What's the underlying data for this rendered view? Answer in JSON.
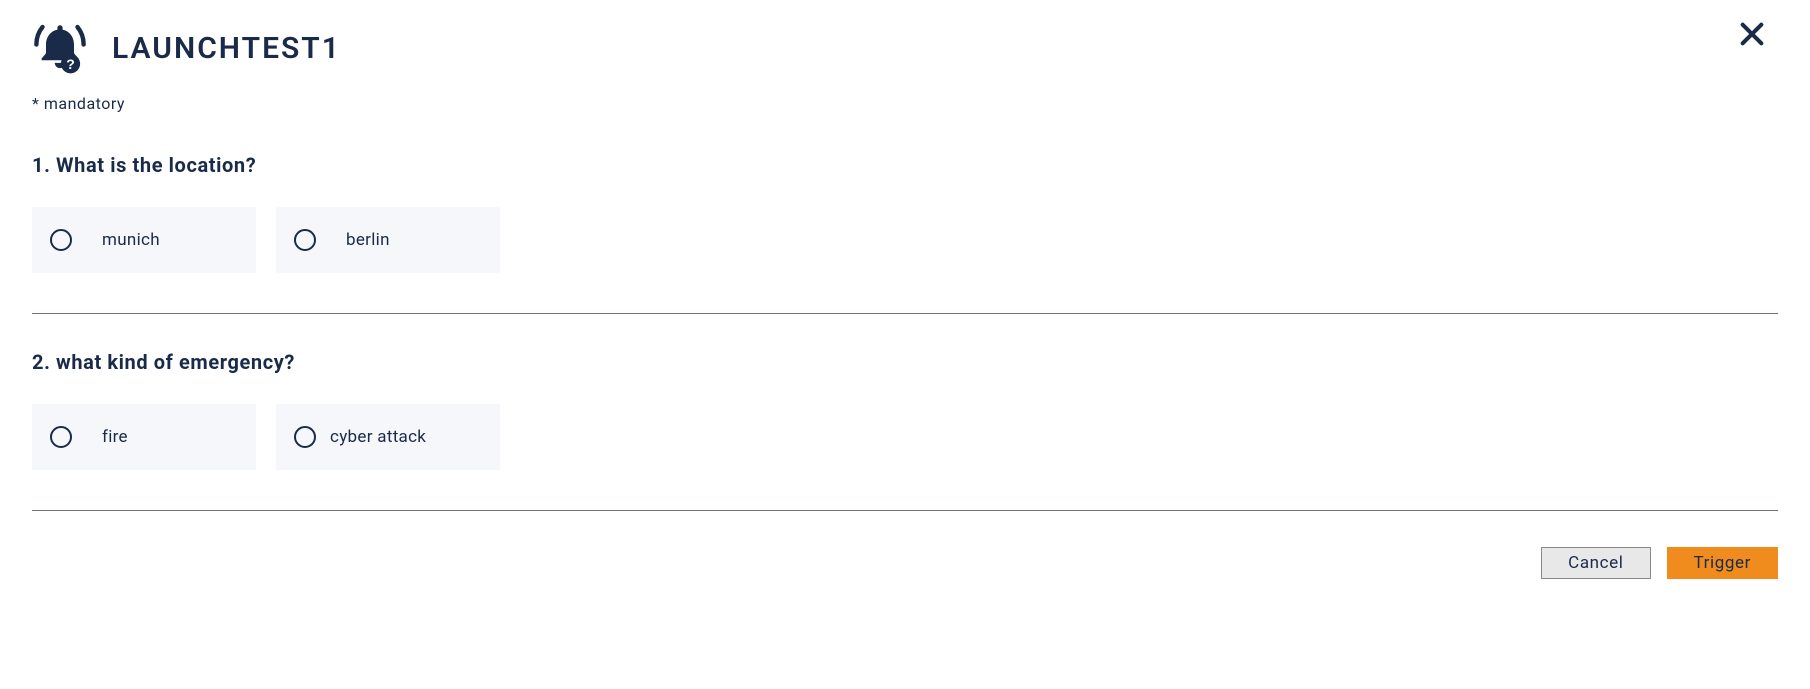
{
  "header": {
    "title": "LAUNCHTEST1"
  },
  "mandatory_note": "* mandatory",
  "questions": [
    {
      "label": "1. What is the location?",
      "options": [
        {
          "label": "munich"
        },
        {
          "label": "berlin"
        }
      ]
    },
    {
      "label": "2. what kind of emergency?",
      "options": [
        {
          "label": "fire"
        },
        {
          "label": "cyber attack"
        }
      ]
    }
  ],
  "footer": {
    "cancel_label": "Cancel",
    "trigger_label": "Trigger"
  }
}
